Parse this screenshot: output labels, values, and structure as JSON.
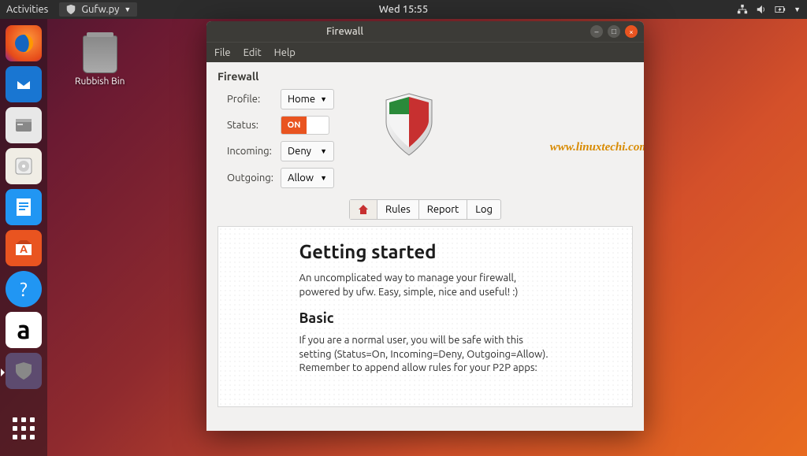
{
  "topbar": {
    "activities": "Activities",
    "app_name": "Gufw.py",
    "clock": "Wed 15:55"
  },
  "desktop": {
    "trash_label": "Rubbish Bin"
  },
  "window": {
    "title": "Firewall",
    "menu": {
      "file": "File",
      "edit": "Edit",
      "help": "Help"
    },
    "section": "Firewall",
    "labels": {
      "profile": "Profile:",
      "status": "Status:",
      "incoming": "Incoming:",
      "outgoing": "Outgoing:"
    },
    "values": {
      "profile": "Home",
      "status_on": "ON",
      "incoming": "Deny",
      "outgoing": "Allow"
    },
    "tabs": {
      "rules": "Rules",
      "report": "Report",
      "log": "Log"
    },
    "content": {
      "h1": "Getting started",
      "p1": "An uncomplicated way to manage your firewall, powered by ufw. Easy, simple, nice and useful! :)",
      "h2": "Basic",
      "p2": "If you are a normal user, you will be safe with this setting (Status=On, Incoming=Deny, Outgoing=Allow). Remember to append allow rules for your P2P apps:"
    },
    "watermark": "www.linuxtechi.com"
  }
}
